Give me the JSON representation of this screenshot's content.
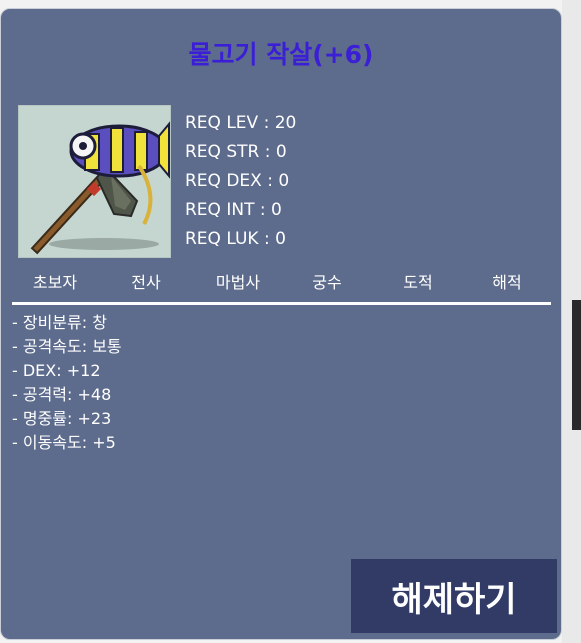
{
  "item": {
    "name": "물고기 작살(+6)",
    "image_icon": "fish-harpoon-icon"
  },
  "requirements": [
    "REQ LEV : 20",
    "REQ STR : 0",
    "REQ DEX : 0",
    "REQ INT : 0",
    "REQ LUK : 0"
  ],
  "jobs": [
    "초보자",
    "전사",
    "마법사",
    "궁수",
    "도적",
    "해적"
  ],
  "stats": [
    "- 장비분류: 창",
    "- 공격속도: 보통",
    "- DEX: +12",
    "- 공격력: +48",
    "- 명중률: +23",
    "- 이동속도: +5"
  ],
  "actions": {
    "release_label": "해제하기"
  },
  "colors": {
    "panel_bg": "#5d6b8c",
    "title": "#3a1fd6",
    "button_bg": "#313b66"
  }
}
